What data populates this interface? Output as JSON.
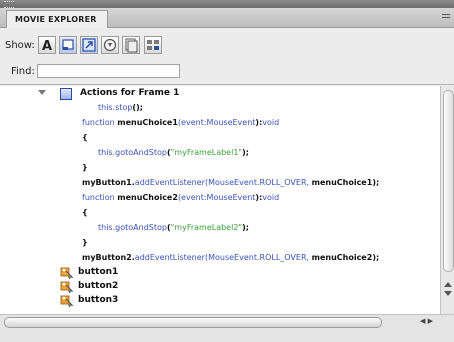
{
  "panel": {
    "tab_title": "MOVIE EXPLORER",
    "show_label": "Show:",
    "show_filters": [
      "text-filter-icon",
      "buttons-movieclips-filter-icon",
      "actionscript-filter-icon",
      "video-sound-bitmap-filter-icon",
      "frames-layers-filter-icon",
      "customize-filter-icon"
    ],
    "find_label": "Find:",
    "find_value": ""
  },
  "tree": {
    "root_label": "Actions for Frame 1",
    "code_lines": [
      {
        "parts": [
          {
            "t": "this.stop",
            "c": "kw"
          },
          {
            "t": "();",
            "c": "bold"
          }
        ]
      },
      {
        "parts": [
          {
            "t": "function ",
            "c": "kw"
          },
          {
            "t": "menuChoice1",
            "c": "bold"
          },
          {
            "t": "(event:MouseEvent",
            "c": "kw"
          },
          {
            "t": "):",
            "c": "bold"
          },
          {
            "t": "void",
            "c": "kw"
          }
        ]
      },
      {
        "parts": [
          {
            "t": "{",
            "c": "bold"
          }
        ]
      },
      {
        "parts": [
          {
            "t": "this.gotoAndStop",
            "c": "kw"
          },
          {
            "t": "(",
            "c": "bold"
          },
          {
            "t": "\"myFrameLabel1\"",
            "c": "str"
          },
          {
            "t": ");",
            "c": "bold"
          }
        ]
      },
      {
        "parts": [
          {
            "t": "}",
            "c": "bold"
          }
        ]
      },
      {
        "parts": [
          {
            "t": "myButton1.",
            "c": "bold"
          },
          {
            "t": "addEventListener",
            "c": "kw"
          },
          {
            "t": "(MouseEvent.ROLL_OVER, ",
            "c": "kw"
          },
          {
            "t": "menuChoice1",
            "c": "bold"
          },
          {
            "t": ");",
            "c": "bold"
          }
        ]
      },
      {
        "parts": [
          {
            "t": "function ",
            "c": "kw"
          },
          {
            "t": "menuChoice2",
            "c": "bold"
          },
          {
            "t": "(event:MouseEvent",
            "c": "kw"
          },
          {
            "t": "):",
            "c": "bold"
          },
          {
            "t": "void",
            "c": "kw"
          }
        ]
      },
      {
        "parts": [
          {
            "t": "{",
            "c": "bold"
          }
        ]
      },
      {
        "parts": [
          {
            "t": "this.gotoAndStop",
            "c": "kw"
          },
          {
            "t": "(",
            "c": "bold"
          },
          {
            "t": "\"myFrameLabel2\"",
            "c": "str"
          },
          {
            "t": ");",
            "c": "bold"
          }
        ]
      },
      {
        "parts": [
          {
            "t": "}",
            "c": "bold"
          }
        ]
      },
      {
        "parts": [
          {
            "t": "myButton2.",
            "c": "bold"
          },
          {
            "t": "addEventListener",
            "c": "kw"
          },
          {
            "t": "(MouseEvent.ROLL_OVER, ",
            "c": "kw"
          },
          {
            "t": "menuChoice2",
            "c": "bold"
          },
          {
            "t": ");",
            "c": "bold"
          }
        ]
      }
    ],
    "buttons": [
      "button1",
      "button2",
      "button3"
    ]
  },
  "colors": {
    "keyword": "#3a53b8",
    "string": "#3aa03a",
    "frame_icon": "#2b4d9c"
  }
}
